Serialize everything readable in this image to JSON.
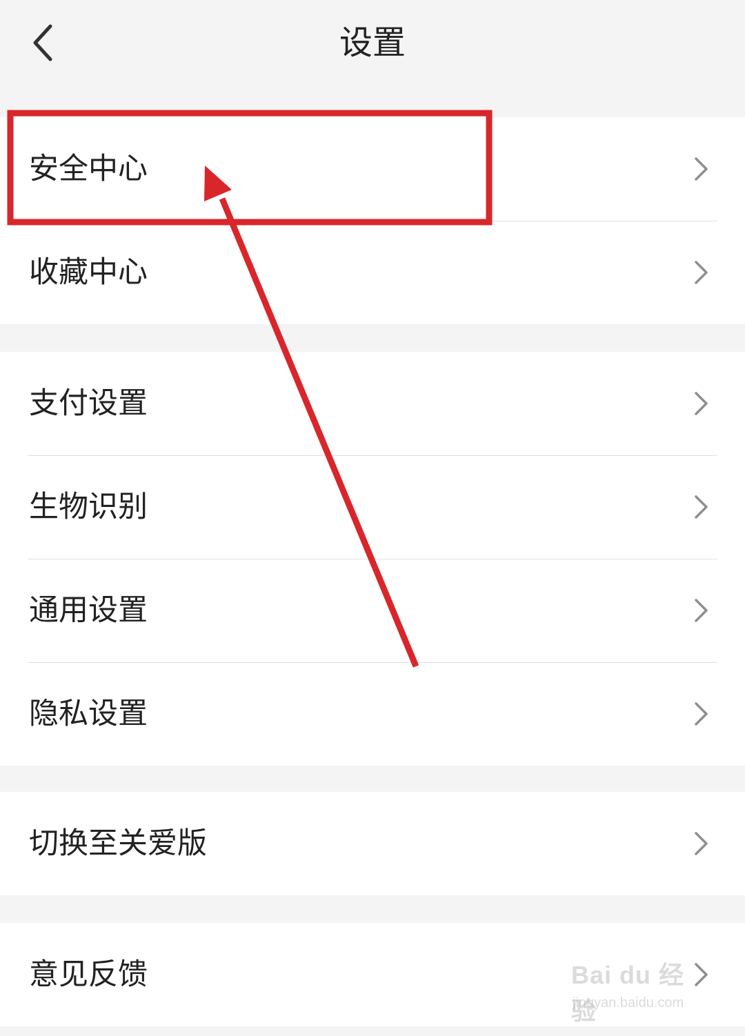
{
  "header": {
    "title": "设置",
    "back_icon": "chevron-left-icon"
  },
  "groups": [
    {
      "items": [
        {
          "label": "安全中心"
        },
        {
          "label": "收藏中心"
        }
      ]
    },
    {
      "items": [
        {
          "label": "支付设置"
        },
        {
          "label": "生物识别"
        },
        {
          "label": "通用设置"
        },
        {
          "label": "隐私设置"
        }
      ]
    },
    {
      "items": [
        {
          "label": "切换至关爱版"
        }
      ]
    },
    {
      "items": [
        {
          "label": "意见反馈"
        }
      ]
    }
  ],
  "annotation": {
    "color": "#d9262b",
    "highlight_target": "安全中心"
  },
  "watermark": {
    "brand": "Bai du 经验",
    "url": "jingyan.baidu.com"
  },
  "colors": {
    "background": "#f4f4f4",
    "row_background": "#ffffff",
    "text": "#222222",
    "chevron": "#8e8e8e"
  }
}
